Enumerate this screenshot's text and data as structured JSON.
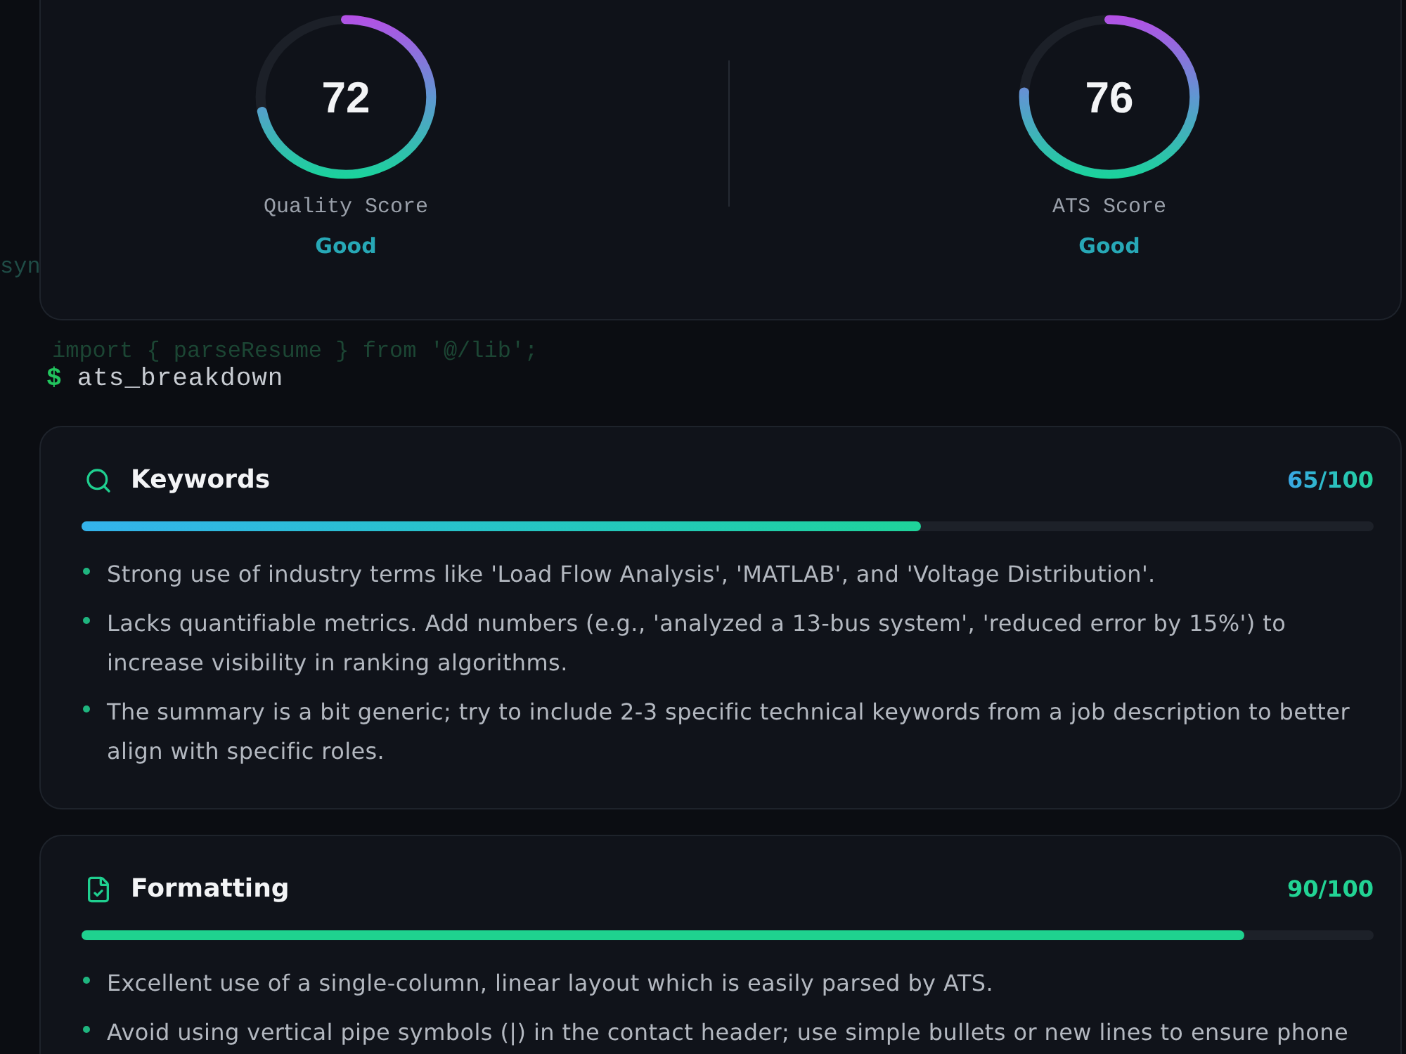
{
  "code_fragments": [
    "syn",
    "import { parseResume } from '@/lib';"
  ],
  "scores": [
    {
      "value": "72",
      "label": "Quality Score",
      "rating": "Good",
      "level": 0.72
    },
    {
      "value": "76",
      "label": "ATS Score",
      "rating": "Good",
      "level": 0.76
    }
  ],
  "prompt": {
    "symbol": "$",
    "command": "ats_breakdown"
  },
  "sections": [
    {
      "kind": "keywords",
      "title": "Keywords",
      "score": "65/100",
      "level": 0.65,
      "items": [
        "Strong use of industry terms like 'Load Flow Analysis', 'MATLAB', and 'Voltage Distribution'.",
        "Lacks quantifiable metrics. Add numbers (e.g., 'analyzed a 13-bus system', 'reduced error by 15%') to increase visibility in ranking algorithms.",
        "The summary is a bit generic; try to include 2-3 specific technical keywords from a job description to better align with specific roles."
      ]
    },
    {
      "kind": "formatting",
      "title": "Formatting",
      "score": "90/100",
      "level": 0.9,
      "items": [
        "Excellent use of a single-column, linear layout which is easily parsed by ATS.",
        "Avoid using vertical pipe symbols (|) in the contact header; use simple bullets or new lines to ensure phone"
      ]
    }
  ]
}
